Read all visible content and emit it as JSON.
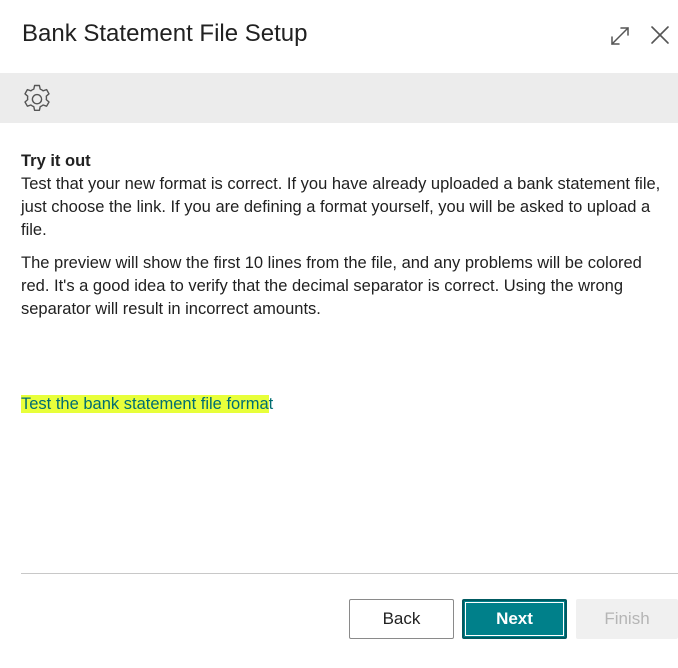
{
  "dialog": {
    "title": "Bank Statement File Setup",
    "expand_icon": "expand-icon",
    "close_icon": "close-icon"
  },
  "action_bar": {
    "settings_icon": "gear-icon"
  },
  "step": {
    "heading": "Try it out",
    "paragraph1": "Test that your new format is correct. If you have already uploaded a bank statement file, just choose the link. If you are defining a format yourself, you will be asked to upload a file.",
    "paragraph2": "The preview will show the first 10 lines from the file, and any problems will be colored red. It's a good idea to verify that the decimal separator is correct. Using the wrong separator will result in incorrect amounts."
  },
  "link": {
    "highlighted_text": "Test the bank statement file forma",
    "trailing_text": "t"
  },
  "footer": {
    "back_label": "Back",
    "next_label": "Next",
    "finish_label": "Finish"
  },
  "colors": {
    "accent": "#00808a",
    "link": "#006d72",
    "highlight": "#e8ff3a",
    "action_bar_bg": "#ececec",
    "disabled_text": "#b5b5b5"
  }
}
